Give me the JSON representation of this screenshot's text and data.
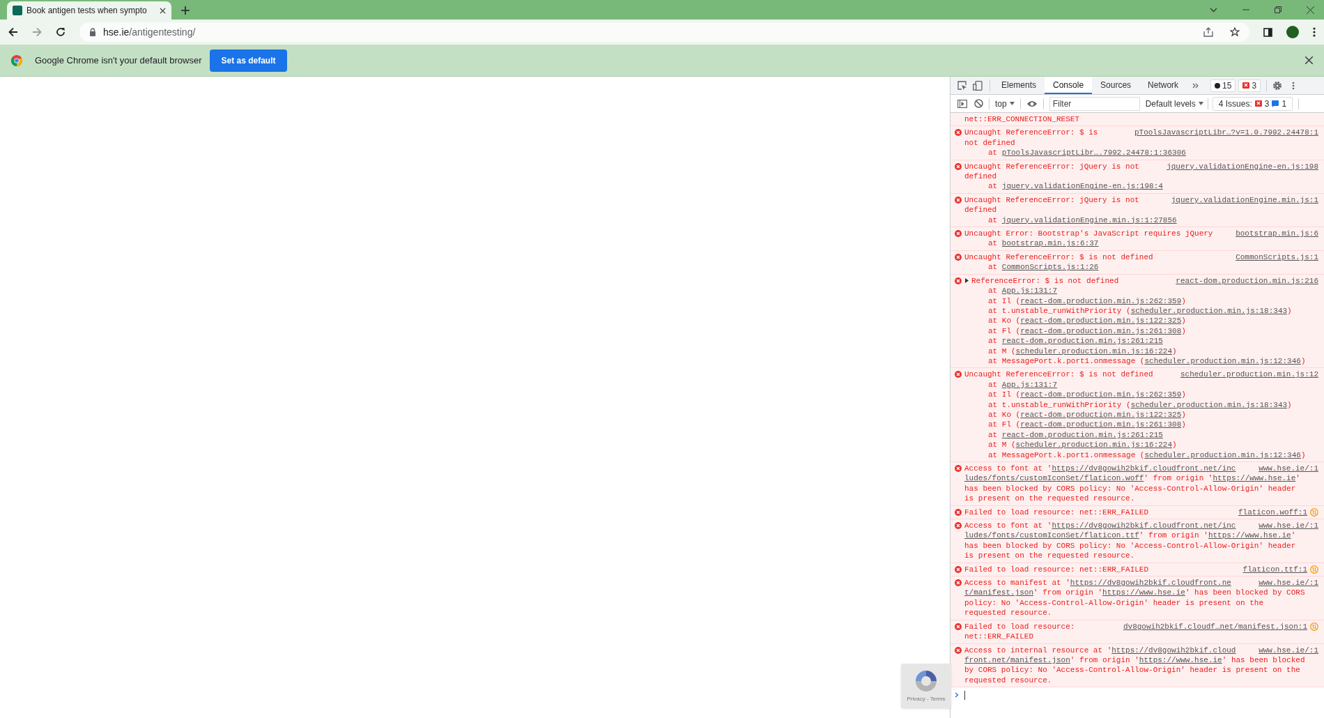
{
  "browser": {
    "tab": {
      "title": "Book antigen tests when sympto",
      "selected": true
    },
    "address": {
      "host": "hse.ie",
      "path": "/antigentesting/"
    },
    "infobar": {
      "message": "Google Chrome isn't your default browser",
      "button": "Set as default"
    }
  },
  "page": {
    "recaptcha": "Privacy - Terms"
  },
  "devtools": {
    "tabs": [
      {
        "label": "Elements",
        "selected": false
      },
      {
        "label": "Console",
        "selected": true
      },
      {
        "label": "Sources",
        "selected": false
      },
      {
        "label": "Network",
        "selected": false
      }
    ],
    "badges": [
      {
        "kind": "messages",
        "count": "15"
      },
      {
        "kind": "errors",
        "count": "3"
      }
    ],
    "context": "top",
    "filter": {
      "placeholder": "Filter"
    },
    "levels": "Default levels",
    "issues": {
      "label": "4 Issues:",
      "errors": "3",
      "info": "1"
    },
    "messages": [
      {
        "kind": "continuation",
        "lines": [
          [
            {
              "t": "net::ERR_CONNECTION_RESET"
            }
          ]
        ]
      },
      {
        "kind": "error",
        "source": "pToolsJavascriptLibr…?v=1.0.7992.24478:1",
        "lines": [
          [
            {
              "t": "Uncaught ReferenceError: $ is"
            }
          ],
          [
            {
              "t": "not defined"
            }
          ]
        ],
        "stack": [
          [
            {
              "t": "at "
            },
            {
              "link": "pToolsJavascriptLibr….7992.24478:1:36306"
            }
          ]
        ]
      },
      {
        "kind": "error",
        "source": "jquery.validationEngine-en.js:198",
        "lines": [
          [
            {
              "t": "Uncaught ReferenceError: jQuery is not"
            }
          ],
          [
            {
              "t": "defined"
            }
          ]
        ],
        "stack": [
          [
            {
              "t": "at "
            },
            {
              "link": "jquery.validationEngine-en.js:198:4"
            }
          ]
        ]
      },
      {
        "kind": "error",
        "source": "jquery.validationEngine.min.js:1",
        "lines": [
          [
            {
              "t": "Uncaught ReferenceError: jQuery is not"
            }
          ],
          [
            {
              "t": "defined"
            }
          ]
        ],
        "stack": [
          [
            {
              "t": "at "
            },
            {
              "link": "jquery.validationEngine.min.js:1:27856"
            }
          ]
        ]
      },
      {
        "kind": "error",
        "source": "bootstrap.min.js:6",
        "lines": [
          [
            {
              "t": "Uncaught Error: Bootstrap's JavaScript requires jQuery"
            }
          ]
        ],
        "stack": [
          [
            {
              "t": "at "
            },
            {
              "link": "bootstrap.min.js:6:37"
            }
          ]
        ]
      },
      {
        "kind": "error",
        "source": "CommonScripts.js:1",
        "lines": [
          [
            {
              "t": "Uncaught ReferenceError: $ is not defined"
            }
          ]
        ],
        "stack": [
          [
            {
              "t": "at "
            },
            {
              "link": "CommonScripts.js:1:26"
            }
          ]
        ]
      },
      {
        "kind": "error",
        "expanded": false,
        "source": "react-dom.production.min.js:216",
        "lines": [
          [
            {
              "t": "ReferenceError: $ is not defined"
            }
          ]
        ],
        "stack": [
          [
            {
              "t": "at "
            },
            {
              "link": "App.js:131:7"
            }
          ],
          [
            {
              "t": "at Il ("
            },
            {
              "link": "react-dom.production.min.js:262:359"
            },
            {
              "t": ")"
            }
          ],
          [
            {
              "t": "at t.unstable_runWithPriority ("
            },
            {
              "link": "scheduler.production.min.js:18:343"
            },
            {
              "t": ")"
            }
          ],
          [
            {
              "t": "at Ko ("
            },
            {
              "link": "react-dom.production.min.js:122:325"
            },
            {
              "t": ")"
            }
          ],
          [
            {
              "t": "at Fl ("
            },
            {
              "link": "react-dom.production.min.js:261:308"
            },
            {
              "t": ")"
            }
          ],
          [
            {
              "t": "at "
            },
            {
              "link": "react-dom.production.min.js:261:215"
            }
          ],
          [
            {
              "t": "at M ("
            },
            {
              "link": "scheduler.production.min.js:16:224"
            },
            {
              "t": ")"
            }
          ],
          [
            {
              "t": "at MessagePort.k.port1.onmessage ("
            },
            {
              "link": "scheduler.production.min.js:12:346"
            },
            {
              "t": ")"
            }
          ]
        ]
      },
      {
        "kind": "error",
        "source": "scheduler.production.min.js:12",
        "lines": [
          [
            {
              "t": "Uncaught ReferenceError: $ is not defined"
            }
          ]
        ],
        "stack": [
          [
            {
              "t": "at "
            },
            {
              "link": "App.js:131:7"
            }
          ],
          [
            {
              "t": "at Il ("
            },
            {
              "link": "react-dom.production.min.js:262:359"
            },
            {
              "t": ")"
            }
          ],
          [
            {
              "t": "at t.unstable_runWithPriority ("
            },
            {
              "link": "scheduler.production.min.js:18:343"
            },
            {
              "t": ")"
            }
          ],
          [
            {
              "t": "at Ko ("
            },
            {
              "link": "react-dom.production.min.js:122:325"
            },
            {
              "t": ")"
            }
          ],
          [
            {
              "t": "at Fl ("
            },
            {
              "link": "react-dom.production.min.js:261:308"
            },
            {
              "t": ")"
            }
          ],
          [
            {
              "t": "at "
            },
            {
              "link": "react-dom.production.min.js:261:215"
            }
          ],
          [
            {
              "t": "at M ("
            },
            {
              "link": "scheduler.production.min.js:16:224"
            },
            {
              "t": ")"
            }
          ],
          [
            {
              "t": "at MessagePort.k.port1.onmessage ("
            },
            {
              "link": "scheduler.production.min.js:12:346"
            },
            {
              "t": ")"
            }
          ]
        ]
      },
      {
        "kind": "error",
        "source": "www.hse.ie/:1",
        "lines": [
          [
            {
              "t": "Access to font at '"
            },
            {
              "link": "https://dv8gowih2bkif.cloudfront.net/inc"
            }
          ],
          [
            {
              "link": "ludes/fonts/customIconSet/flaticon.woff"
            },
            {
              "t": "' from origin '"
            },
            {
              "link": "https://www.hse.ie"
            },
            {
              "t": "'"
            }
          ],
          [
            {
              "t": "has been blocked by CORS policy: No 'Access-Control-Allow-Origin' header"
            }
          ],
          [
            {
              "t": "is present on the requested resource."
            }
          ]
        ]
      },
      {
        "kind": "error",
        "network": true,
        "source": "flaticon.woff:1",
        "lines": [
          [
            {
              "t": "Failed to load resource: net::ERR_FAILED"
            }
          ]
        ]
      },
      {
        "kind": "error",
        "source": "www.hse.ie/:1",
        "lines": [
          [
            {
              "t": "Access to font at '"
            },
            {
              "link": "https://dv8gowih2bkif.cloudfront.net/inc"
            }
          ],
          [
            {
              "link": "ludes/fonts/customIconSet/flaticon.ttf"
            },
            {
              "t": "' from origin '"
            },
            {
              "link": "https://www.hse.ie"
            },
            {
              "t": "'"
            }
          ],
          [
            {
              "t": "has been blocked by CORS policy: No 'Access-Control-Allow-Origin' header"
            }
          ],
          [
            {
              "t": "is present on the requested resource."
            }
          ]
        ]
      },
      {
        "kind": "error",
        "network": true,
        "source": "flaticon.ttf:1",
        "lines": [
          [
            {
              "t": "Failed to load resource: net::ERR_FAILED"
            }
          ]
        ]
      },
      {
        "kind": "error",
        "source": "www.hse.ie/:1",
        "lines": [
          [
            {
              "t": "Access to manifest at '"
            },
            {
              "link": "https://dv8gowih2bkif.cloudfront.ne"
            }
          ],
          [
            {
              "link": "t/manifest.json"
            },
            {
              "t": "' from origin '"
            },
            {
              "link": "https://www.hse.ie"
            },
            {
              "t": "' has been blocked by CORS"
            }
          ],
          [
            {
              "t": "policy: No 'Access-Control-Allow-Origin' header is present on the"
            }
          ],
          [
            {
              "t": "requested resource."
            }
          ]
        ]
      },
      {
        "kind": "error",
        "network": true,
        "source": "dv8gowih2bkif.cloudf…net/manifest.json:1",
        "lines": [
          [
            {
              "t": "Failed to load resource:"
            }
          ],
          [
            {
              "t": "net::ERR_FAILED"
            }
          ]
        ]
      },
      {
        "kind": "error",
        "source": "www.hse.ie/:1",
        "lines": [
          [
            {
              "t": "Access to internal resource at '"
            },
            {
              "link": "https://dv8gowih2bkif.cloud"
            }
          ],
          [
            {
              "link": "front.net/manifest.json"
            },
            {
              "t": "' from origin '"
            },
            {
              "link": "https://www.hse.ie"
            },
            {
              "t": "' has been blocked"
            }
          ],
          [
            {
              "t": "by CORS policy: No 'Access-Control-Allow-Origin' header is present on the"
            }
          ],
          [
            {
              "t": "requested resource."
            }
          ]
        ]
      }
    ]
  }
}
